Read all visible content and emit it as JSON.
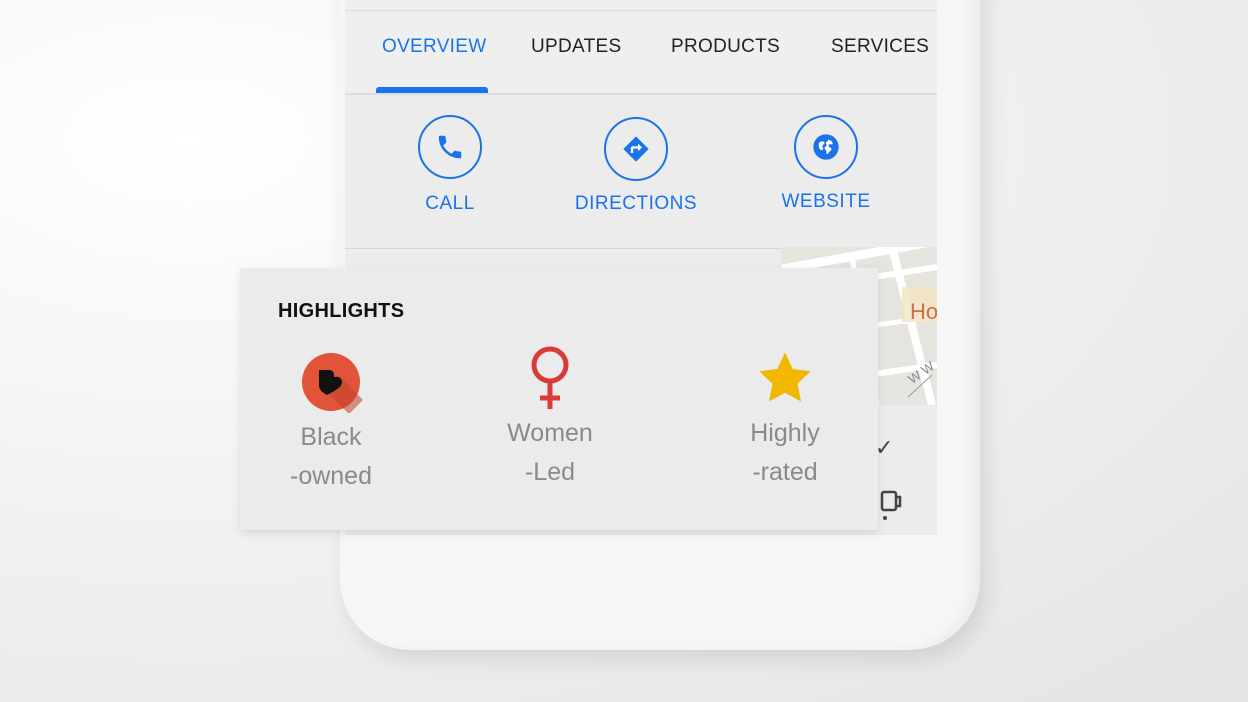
{
  "tabs": [
    {
      "label": "OVERVIEW",
      "active": true
    },
    {
      "label": "UPDATES",
      "active": false
    },
    {
      "label": "PRODUCTS",
      "active": false
    },
    {
      "label": "SERVICES",
      "active": false
    }
  ],
  "actions": [
    {
      "label": "CALL",
      "icon": "phone-icon"
    },
    {
      "label": "DIRECTIONS",
      "icon": "directions-icon"
    },
    {
      "label": "WEBSITE",
      "icon": "globe-icon"
    }
  ],
  "map": {
    "place_fragment": "Ho",
    "street_fragment": "W W"
  },
  "highlights": {
    "title": "HIGHLIGHTS",
    "items": [
      {
        "line1": "Black",
        "line2": "-owned",
        "icon": "black-owned-heart-icon",
        "color": "#e2543a"
      },
      {
        "line1": "Women",
        "line2": "-Led",
        "icon": "female-symbol-icon",
        "color": "#d93b3b"
      },
      {
        "line1": "Highly",
        "line2": "-rated",
        "icon": "star-icon",
        "color": "#f2b800"
      }
    ]
  },
  "colors": {
    "accent": "#1a73e8",
    "highlight_text": "#8a8a8a"
  }
}
